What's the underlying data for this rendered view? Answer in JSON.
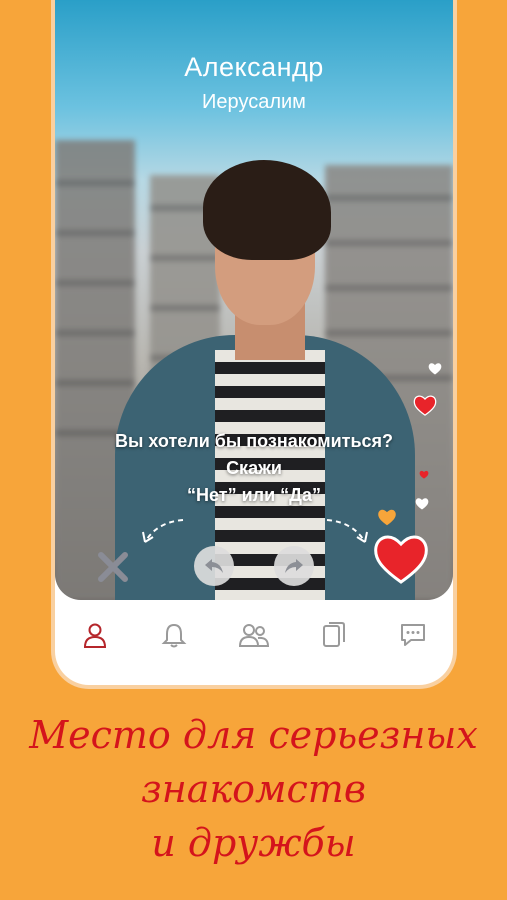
{
  "profile": {
    "name": "Александр",
    "city": "Иерусалим",
    "prompt_line1": "Вы хотели бы познакомиться?",
    "prompt_line2": "Скажи",
    "prompt_line3": "“Нет” или “Да”"
  },
  "actions": {
    "dislike_icon": "close-icon",
    "undo_icon": "undo-icon",
    "redo_icon": "redo-icon",
    "like_icon": "heart-icon"
  },
  "tabs": [
    {
      "icon": "profile-icon",
      "active": true
    },
    {
      "icon": "bell-icon",
      "active": false
    },
    {
      "icon": "people-icon",
      "active": false
    },
    {
      "icon": "cards-icon",
      "active": false
    },
    {
      "icon": "chat-icon",
      "active": false
    }
  ],
  "tagline": {
    "line1": "Место для серьезных",
    "line2": "знакомств",
    "line3": "и дружбы"
  },
  "colors": {
    "background": "#F7A53A",
    "accent_red": "#E8242A",
    "tagline": "#D4141C",
    "active_tab": "#B5262B",
    "inactive_tab": "#9A9A9A"
  }
}
